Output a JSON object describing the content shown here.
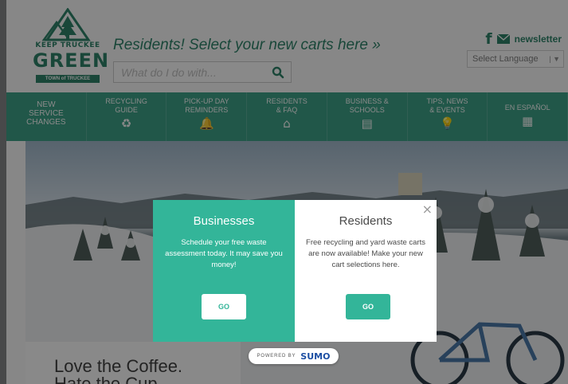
{
  "header": {
    "logo": {
      "top_text": "KEEP TRUCKEE",
      "main_text": "GREEN",
      "sub_text": "TOWN of TRUCKEE"
    },
    "tagline": "Residents! Select your new carts here »",
    "search": {
      "placeholder": "What do I do with..."
    },
    "social": {
      "facebook": "f",
      "newsletter": "newsletter"
    },
    "language_select": {
      "selected": "Select Language"
    }
  },
  "nav": {
    "items": [
      {
        "label": "NEW\nSERVICE\nCHANGES",
        "icon": ""
      },
      {
        "label": "RECYCLING\nGUIDE",
        "icon": "♻"
      },
      {
        "label": "PICK-UP DAY\nREMINDERS",
        "icon": "🔔"
      },
      {
        "label": "RESIDENTS\n& FAQ",
        "icon": "⌂"
      },
      {
        "label": "BUSINESS &\nSCHOOLS",
        "icon": "▤"
      },
      {
        "label": "TIPS, NEWS\n& EVENTS",
        "icon": "💡"
      },
      {
        "label": "EN ESPAÑOL",
        "icon": "▦"
      }
    ]
  },
  "hero": {
    "quote": "Love the Coffee.\nHate the Cup."
  },
  "modal": {
    "businesses": {
      "title": "Businesses",
      "body": "Schedule your free waste assessment today. It may save you money!",
      "button": "GO"
    },
    "residents": {
      "title": "Residents",
      "body": "Free recycling and yard waste carts are now available! Make your new cart selections here.",
      "button": "GO"
    },
    "close": "×"
  },
  "powered_by": {
    "label": "POWERED BY",
    "brand": "SUMO"
  },
  "colors": {
    "green": "#2f9b7f",
    "teal": "#33b599",
    "brand_dark": "#1e7a5e"
  }
}
